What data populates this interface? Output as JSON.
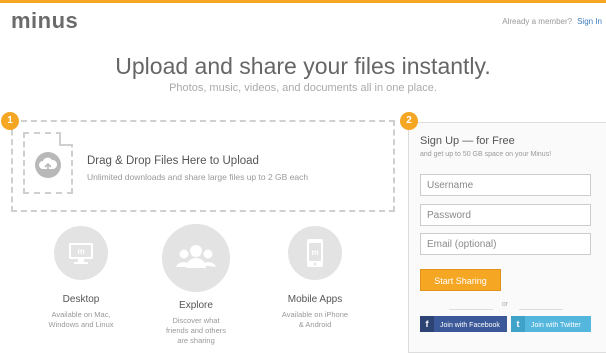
{
  "app": {
    "logo": "minus"
  },
  "header": {
    "member_text": "Already a member?",
    "sign_in": "Sign In"
  },
  "hero": {
    "title": "Upload and share your files instantly.",
    "subtitle": "Photos, music, videos, and documents all in one place."
  },
  "steps": {
    "one": "1",
    "two": "2"
  },
  "dropzone": {
    "title": "Drag & Drop Files Here to Upload",
    "subtitle": "Unlimited downloads and share large files up to 2 GB each"
  },
  "features": [
    {
      "title": "Desktop",
      "desc1": "Available on Mac,",
      "desc2": "Windows and Linux",
      "desc3": "",
      "icon": "monitor-icon"
    },
    {
      "title": "Explore",
      "desc1": "Discover what",
      "desc2": "friends and others",
      "desc3": "are sharing",
      "icon": "people-icon"
    },
    {
      "title": "Mobile Apps",
      "desc1": "Available on iPhone",
      "desc2": "& Android",
      "desc3": "",
      "icon": "phone-icon"
    }
  ],
  "signup": {
    "title": "Sign Up — for Free",
    "subtitle": "and get up to 50 GB space on your Minus!",
    "username_placeholder": "Username",
    "password_placeholder": "Password",
    "email_placeholder": "Email (optional)",
    "button": "Start Sharing",
    "or": "or",
    "facebook": "Join with Facebook",
    "twitter": "Join with Twitter",
    "facebook_icon_letter": "f",
    "twitter_icon_letter": "t"
  },
  "colors": {
    "accent": "#f5a623",
    "link": "#3b7bbf",
    "facebook": "#3b5998",
    "twitter": "#55b7dd"
  }
}
